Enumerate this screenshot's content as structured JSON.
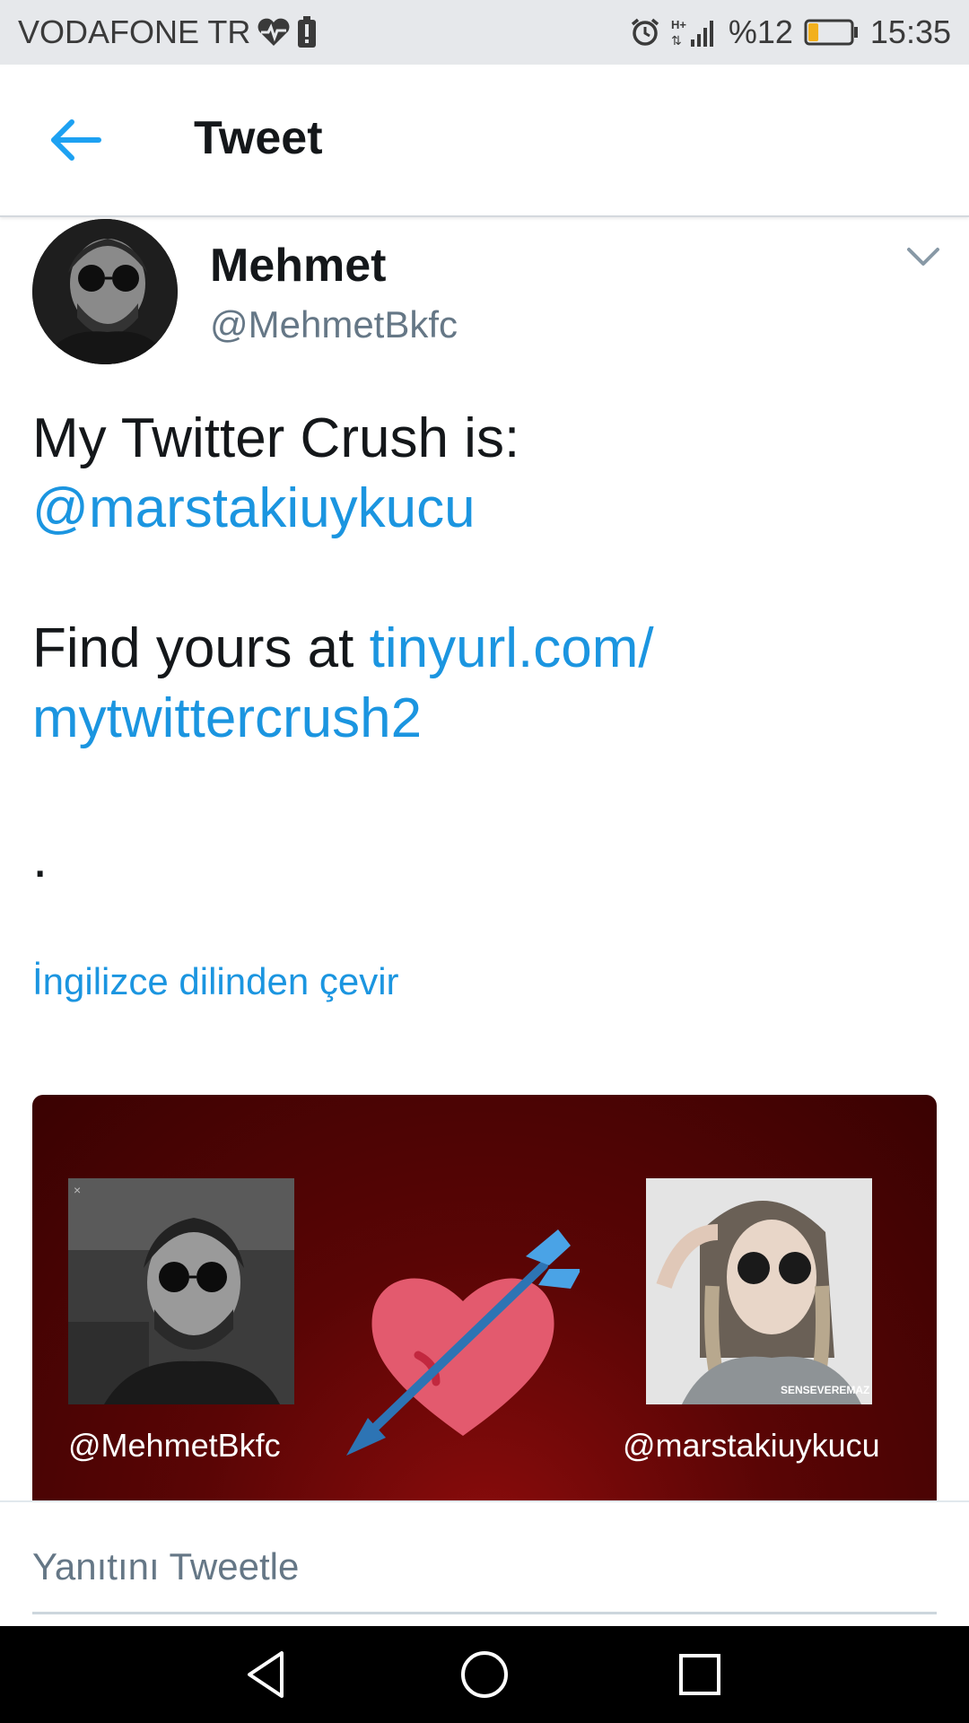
{
  "status_bar": {
    "carrier": "VODAFONE TR",
    "battery_percent": "%12",
    "battery_level": 0.12,
    "time": "15:35",
    "icons": [
      "heart-pulse-icon",
      "battery-alert-icon",
      "alarm-icon",
      "signal-icon",
      "battery-icon"
    ]
  },
  "header": {
    "title": "Tweet",
    "back_icon": "arrow-left-icon",
    "accent_color": "#1da1f2"
  },
  "tweet": {
    "display_name": "Mehmet",
    "handle": "@MehmetBkfc",
    "text_line1": "My Twitter Crush is:",
    "mention": "@marstakiuykucu",
    "find_prefix": "Find yours at ",
    "link_part1": "tinyurl.com/",
    "link_part2": "mytwittercrush2",
    "dot": ".",
    "translate_label": "İngilizce dilinden çevir",
    "link_color": "#1b95e0"
  },
  "card": {
    "left_handle": "@MehmetBkfc",
    "right_handle": "@marstakiuykucu",
    "watermark": "SENSEVEREMAZ",
    "background_color": "#5a0505"
  },
  "reply": {
    "placeholder": "Yanıtını Tweetle"
  },
  "nav": {
    "icons": [
      "back-triangle-icon",
      "home-circle-icon",
      "recents-square-icon"
    ]
  }
}
